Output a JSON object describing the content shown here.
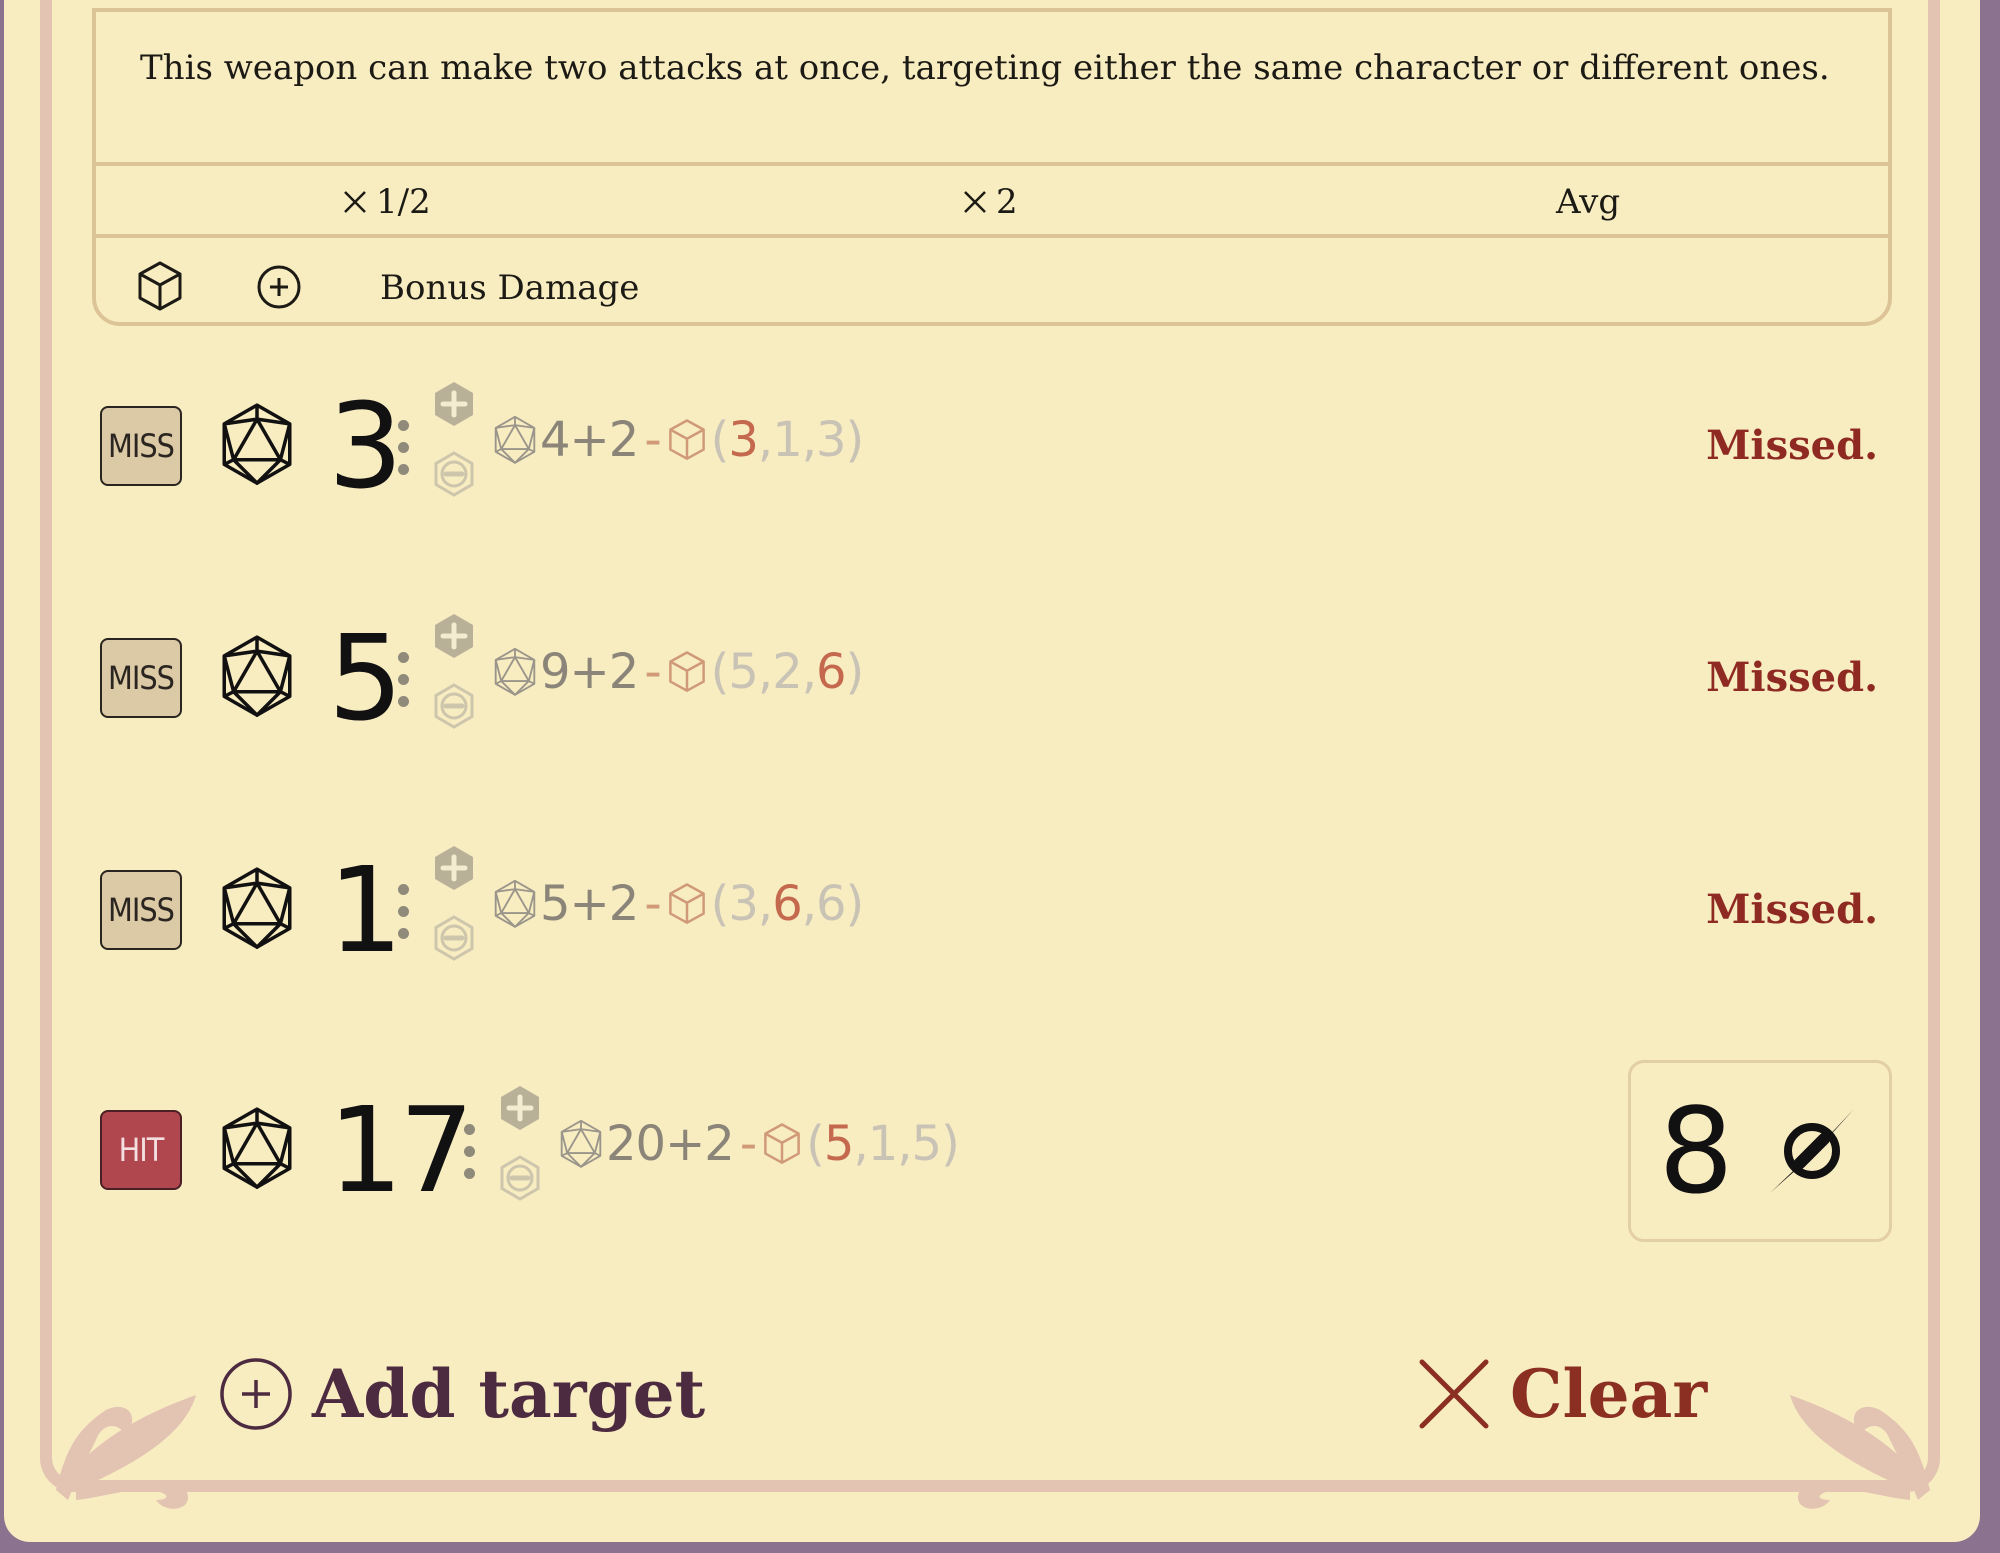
{
  "weapon": {
    "description": "This weapon can make two attacks at once, targeting either the same character or different ones.",
    "table_headers": [
      {
        "prefix_icon": "times-icon",
        "label": "1/2"
      },
      {
        "prefix_icon": "times-icon",
        "label": "2"
      },
      {
        "label": "Avg"
      }
    ],
    "bonus_row": {
      "icons": [
        "cube-die-icon",
        "plus-circle-icon"
      ],
      "label": "Bonus Damage"
    }
  },
  "rolls": [
    {
      "result": "MISS",
      "total": "3",
      "d20": "4",
      "modifier": "+2",
      "separator": "-",
      "dice": [
        {
          "v": "3",
          "hi": true
        },
        {
          "v": "1",
          "hi": false
        },
        {
          "v": "3",
          "hi": false
        }
      ],
      "status": "Missed."
    },
    {
      "result": "MISS",
      "total": "5",
      "d20": "9",
      "modifier": "+2",
      "separator": "-",
      "dice": [
        {
          "v": "5",
          "hi": false
        },
        {
          "v": "2",
          "hi": false
        },
        {
          "v": "6",
          "hi": true
        }
      ],
      "status": "Missed."
    },
    {
      "result": "MISS",
      "total": "1",
      "d20": "5",
      "modifier": "+2",
      "separator": "-",
      "dice": [
        {
          "v": "3",
          "hi": false
        },
        {
          "v": "6",
          "hi": true
        },
        {
          "v": "6",
          "hi": false
        }
      ],
      "status": "Missed."
    },
    {
      "result": "HIT",
      "total": "17",
      "d20": "20",
      "modifier": "+2",
      "separator": "-",
      "dice": [
        {
          "v": "5",
          "hi": true
        },
        {
          "v": "1",
          "hi": false
        },
        {
          "v": "5",
          "hi": false
        }
      ],
      "damage": {
        "value": "8",
        "type_icon": "piercing-icon"
      }
    }
  ],
  "footer": {
    "add_target_label": "Add target",
    "clear_label": "Clear"
  },
  "colors": {
    "background": "#8b7390",
    "paper": "#f8ecc1",
    "frame": "#e3c3b2",
    "miss_badge": "#dcc9a5",
    "hit_badge": "#b0474f",
    "missed_text": "#8e2a22",
    "add_target_text": "#4c2a40",
    "clear_text": "#8a2f22",
    "highlight_die": "#c4694e"
  }
}
